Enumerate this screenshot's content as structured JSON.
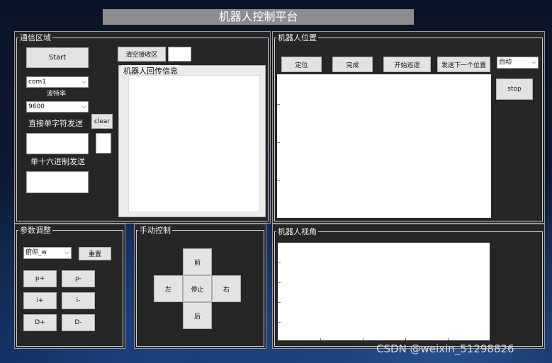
{
  "title": "机器人控制平台",
  "comm": {
    "group": "通信区域",
    "start": "Start",
    "port_value": "com1",
    "baud_label": "波特率",
    "baud_value": "9600",
    "char_send_label": "直接单字符发送",
    "clear": "clear",
    "hex_send_label": "单十六进制发送",
    "clear_receive": "清空接收区",
    "return_group": "机器人回传信息"
  },
  "position": {
    "group": "机器人位置",
    "buttons": [
      "定位",
      "完成",
      "开始巡逻",
      "发送下一个位置"
    ],
    "mode_value": "自动",
    "stop": "stop"
  },
  "params": {
    "group": "参数调整",
    "param_value": "俯仰_w",
    "reset": "重置",
    "buttons": [
      "p+",
      "p-",
      "i+",
      "i-",
      "D+",
      "D-"
    ]
  },
  "manual": {
    "group": "手动控制",
    "forward": "前",
    "left": "左",
    "stop": "停止",
    "right": "右",
    "back": "后"
  },
  "view": {
    "group": "机器人视角"
  },
  "watermark": "CSDN @weixin_51298826"
}
